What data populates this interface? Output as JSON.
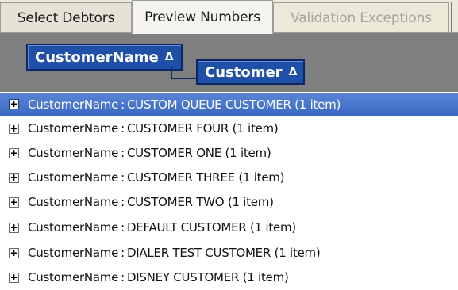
{
  "tabs": [
    {
      "label": "Select Debtors",
      "state": "inactive"
    },
    {
      "label": "Preview Numbers",
      "state": "active"
    },
    {
      "label": "Validation Exceptions",
      "state": "disabled"
    }
  ],
  "groupby": {
    "chips": [
      {
        "label": "CustomerName",
        "arrow": "Δ"
      },
      {
        "label": "Customer",
        "arrow": "Δ"
      }
    ]
  },
  "grid": {
    "expander_glyph": "+",
    "rows": [
      {
        "field": "CustomerName",
        "separator": ":",
        "value": "CUSTOM QUEUE CUSTOMER",
        "count": "(1 item)",
        "selected": true
      },
      {
        "field": "CustomerName",
        "separator": ":",
        "value": "CUSTOMER FOUR",
        "count": "(1 item)",
        "selected": false
      },
      {
        "field": "CustomerName",
        "separator": ":",
        "value": "CUSTOMER ONE",
        "count": "(1 item)",
        "selected": false
      },
      {
        "field": "CustomerName",
        "separator": ":",
        "value": "CUSTOMER THREE",
        "count": "(1 item)",
        "selected": false
      },
      {
        "field": "CustomerName",
        "separator": ":",
        "value": "CUSTOMER TWO",
        "count": "(1 item)",
        "selected": false
      },
      {
        "field": "CustomerName",
        "separator": ":",
        "value": "DEFAULT CUSTOMER",
        "count": "(1 item)",
        "selected": false
      },
      {
        "field": "CustomerName",
        "separator": ":",
        "value": "DIALER TEST CUSTOMER",
        "count": "(1 item)",
        "selected": false
      },
      {
        "field": "CustomerName",
        "separator": ":",
        "value": "DISNEY CUSTOMER",
        "count": "(1 item)",
        "selected": false
      }
    ]
  },
  "colors": {
    "selection": "#3a68c2",
    "chip": "#1f4fa7",
    "groupby_background": "#7f7f7f",
    "tab_background": "#ece9d8"
  }
}
